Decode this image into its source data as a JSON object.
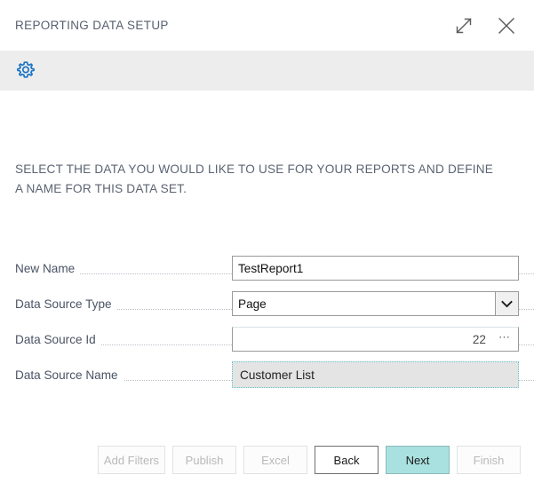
{
  "window": {
    "title": "REPORTING DATA SETUP",
    "expand_icon": "expand-diagonal-icon",
    "close_icon": "close-icon"
  },
  "toolbar": {
    "settings_icon": "gear-icon"
  },
  "content": {
    "instructions": "SELECT THE DATA YOU WOULD LIKE TO USE FOR YOUR REPORTS AND DEFINE A NAME FOR THIS DATA SET."
  },
  "form": {
    "fields": [
      {
        "label": "New Name",
        "type": "text",
        "value": "TestReport1",
        "placeholder": ""
      },
      {
        "label": "Data Source Type",
        "type": "select",
        "value": "Page",
        "chevron_icon": "chevron-down-icon"
      },
      {
        "label": "Data Source Id",
        "type": "lookup",
        "value": "22",
        "lookup_icon": "ellipsis-icon"
      },
      {
        "label": "Data Source Name",
        "type": "readonly-focused",
        "value": "Customer List"
      }
    ]
  },
  "footer": {
    "buttons": [
      {
        "label": "Add Filters",
        "state": "disabled"
      },
      {
        "label": "Publish",
        "state": "disabled"
      },
      {
        "label": "Excel",
        "state": "disabled"
      },
      {
        "label": "Back",
        "state": "enabled"
      },
      {
        "label": "Next",
        "state": "primary"
      },
      {
        "label": "Finish",
        "state": "disabled"
      }
    ]
  },
  "colors": {
    "accent": "#a8e1e0",
    "icon_blue": "#1b74c4",
    "toolbar_bg": "#ededed",
    "focus_border": "#63c4cc",
    "label_text": "#4a5364"
  }
}
